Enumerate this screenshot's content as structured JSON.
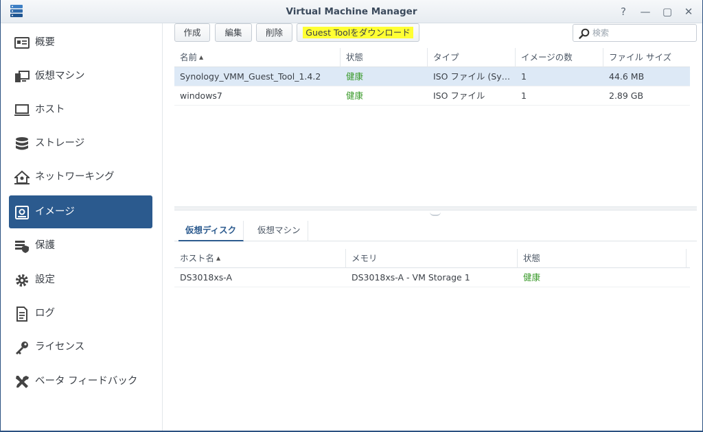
{
  "window": {
    "title": "Virtual Machine Manager"
  },
  "colors": {
    "accent": "#2b5a8e",
    "status_ok": "#3a9a2b",
    "highlight": "#ffff33"
  },
  "window_controls": [
    {
      "name": "help",
      "glyph": "?"
    },
    {
      "name": "minimize",
      "glyph": "—"
    },
    {
      "name": "maximize",
      "glyph": "▢"
    },
    {
      "name": "close",
      "glyph": "✕"
    }
  ],
  "sidebar": {
    "items": [
      {
        "label": "概要",
        "icon": "overview-icon"
      },
      {
        "label": "仮想マシン",
        "icon": "virtual-machine-icon"
      },
      {
        "label": "ホスト",
        "icon": "host-icon"
      },
      {
        "label": "ストレージ",
        "icon": "storage-icon"
      },
      {
        "label": "ネットワーキング",
        "icon": "network-icon"
      },
      {
        "label": "イメージ",
        "icon": "image-icon",
        "active": true
      },
      {
        "label": "保護",
        "icon": "protection-icon"
      },
      {
        "label": "設定",
        "icon": "settings-icon"
      },
      {
        "label": "ログ",
        "icon": "log-icon"
      },
      {
        "label": "ライセンス",
        "icon": "license-icon"
      },
      {
        "label": "ベータ フィードバック",
        "icon": "feedback-icon"
      }
    ]
  },
  "toolbar": {
    "create_label": "作成",
    "edit_label": "編集",
    "delete_label": "削除",
    "guest_tool_label": "Guest Toolをダウンロード",
    "search_placeholder": "検索"
  },
  "images_table": {
    "columns": [
      "名前",
      "状態",
      "タイプ",
      "イメージの数",
      "ファイル サイズ"
    ],
    "rows": [
      {
        "name": "Synology_VMM_Guest_Tool_1.4.2",
        "status": "健康",
        "type": "ISO ファイル (Synology)",
        "count": "1",
        "size": "44.6 MB"
      },
      {
        "name": "windows7",
        "status": "健康",
        "type": "ISO ファイル",
        "count": "1",
        "size": "2.89 GB"
      }
    ]
  },
  "detail_tabs": [
    "仮想ディスク",
    "仮想マシン"
  ],
  "disk_table": {
    "columns": [
      "ホスト名",
      "メモリ",
      "状態"
    ],
    "rows": [
      {
        "host": "DS3018xs-A",
        "memory": "DS3018xs-A - VM Storage 1",
        "status": "健康"
      }
    ]
  }
}
